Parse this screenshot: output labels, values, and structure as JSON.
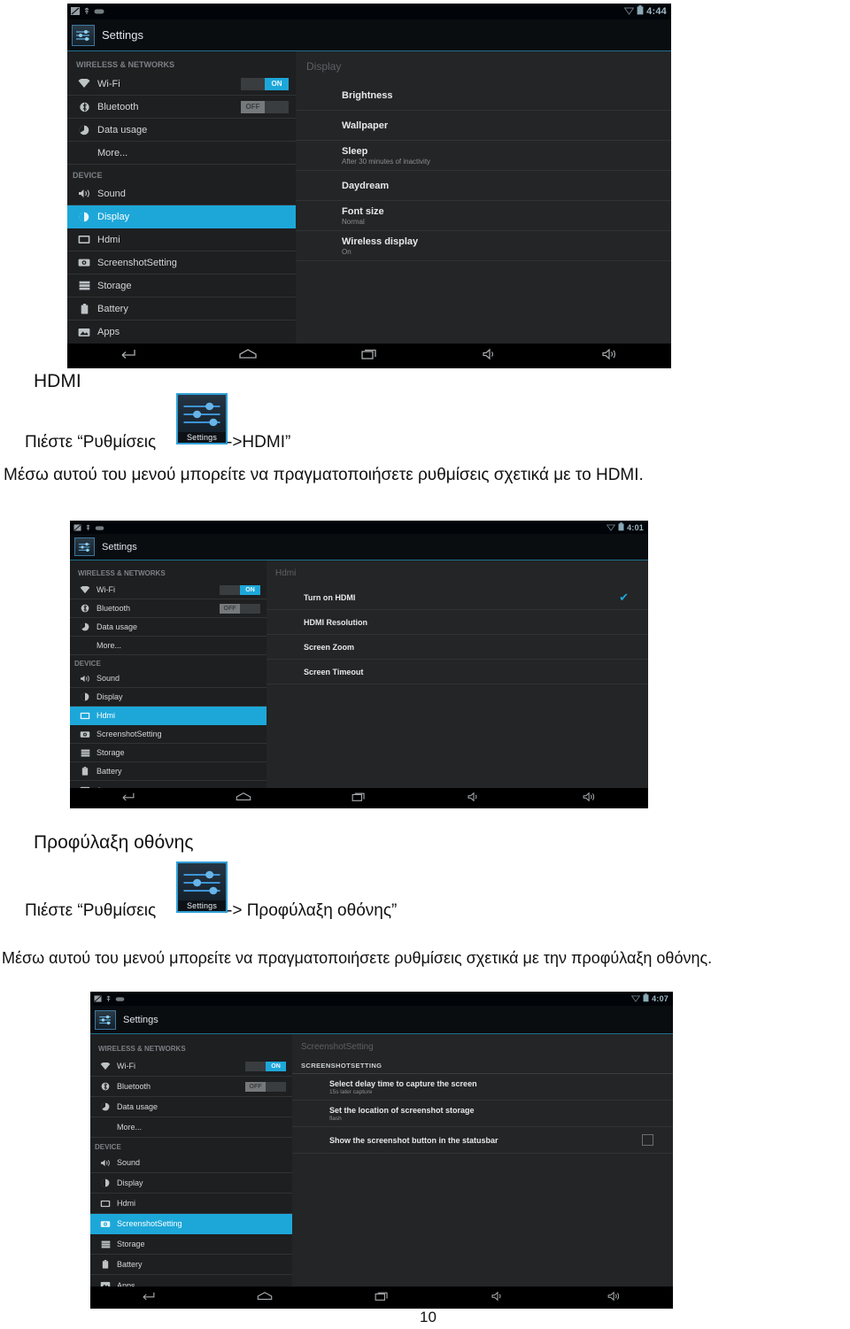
{
  "page": {
    "number": "10"
  },
  "screens": [
    {
      "id": "display-screen",
      "statusbar": {
        "clock": "4:44",
        "icons": [
          "screenshot-icon",
          "usb-icon",
          "battery-icon"
        ]
      },
      "actionbar": {
        "title": "Settings",
        "icon": "settings-app-icon"
      },
      "sidebar": {
        "groups": [
          {
            "label": "WIRELESS & NETWORKS",
            "items": [
              {
                "label": "Wi-Fi",
                "icon": "wifi-icon",
                "toggle": "ON",
                "toggle_state": "on",
                "selected": false
              },
              {
                "label": "Bluetooth",
                "icon": "bluetooth-icon",
                "toggle": "OFF",
                "toggle_state": "off",
                "selected": false
              },
              {
                "label": "Data usage",
                "icon": "data-usage-icon",
                "selected": false
              },
              {
                "label": "More...",
                "icon": "none",
                "selected": false
              }
            ]
          },
          {
            "label": "DEVICE",
            "items": [
              {
                "label": "Sound",
                "icon": "sound-icon",
                "selected": false
              },
              {
                "label": "Display",
                "icon": "display-icon",
                "selected": true
              },
              {
                "label": "Hdmi",
                "icon": "hdmi-icon",
                "selected": false
              },
              {
                "label": "ScreenshotSetting",
                "icon": "camera-icon",
                "selected": false
              },
              {
                "label": "Storage",
                "icon": "storage-icon",
                "selected": false
              },
              {
                "label": "Battery",
                "icon": "battery-icon",
                "selected": false
              },
              {
                "label": "Apps",
                "icon": "apps-icon",
                "selected": false
              }
            ]
          }
        ]
      },
      "content": {
        "title": "Display",
        "section_header": "",
        "rows": [
          {
            "main": "Brightness",
            "desc": "",
            "control": "none"
          },
          {
            "main": "Wallpaper",
            "desc": "",
            "control": "none"
          },
          {
            "main": "Sleep",
            "desc": "After 30 minutes of inactivity",
            "control": "none"
          },
          {
            "main": "Daydream",
            "desc": "",
            "control": "none"
          },
          {
            "main": "Font size",
            "desc": "Normal",
            "control": "none"
          },
          {
            "main": "Wireless display",
            "desc": "On",
            "control": "none"
          }
        ]
      },
      "navbar": [
        "back-icon",
        "home-icon",
        "recents-icon",
        "volume-down-icon",
        "volume-up-icon"
      ]
    },
    {
      "id": "hdmi-screen",
      "statusbar": {
        "clock": "4:01",
        "icons": [
          "screenshot-icon",
          "usb-icon",
          "battery-icon"
        ]
      },
      "actionbar": {
        "title": "Settings",
        "icon": "settings-app-icon"
      },
      "sidebar": {
        "groups": [
          {
            "label": "WIRELESS & NETWORKS",
            "items": [
              {
                "label": "Wi-Fi",
                "icon": "wifi-icon",
                "toggle": "ON",
                "toggle_state": "on",
                "selected": false
              },
              {
                "label": "Bluetooth",
                "icon": "bluetooth-icon",
                "toggle": "OFF",
                "toggle_state": "off",
                "selected": false
              },
              {
                "label": "Data usage",
                "icon": "data-usage-icon",
                "selected": false
              },
              {
                "label": "More...",
                "icon": "none",
                "selected": false
              }
            ]
          },
          {
            "label": "DEVICE",
            "items": [
              {
                "label": "Sound",
                "icon": "sound-icon",
                "selected": false
              },
              {
                "label": "Display",
                "icon": "display-icon",
                "selected": false
              },
              {
                "label": "Hdmi",
                "icon": "hdmi-icon",
                "selected": true
              },
              {
                "label": "ScreenshotSetting",
                "icon": "camera-icon",
                "selected": false
              },
              {
                "label": "Storage",
                "icon": "storage-icon",
                "selected": false
              },
              {
                "label": "Battery",
                "icon": "battery-icon",
                "selected": false
              },
              {
                "label": "Apps",
                "icon": "apps-icon",
                "selected": false
              }
            ]
          }
        ]
      },
      "content": {
        "title": "Hdmi",
        "section_header": "",
        "rows": [
          {
            "main": "Turn on HDMI",
            "desc": "",
            "control": "checkbox-checked"
          },
          {
            "main": "HDMI Resolution",
            "desc": "",
            "control": "none"
          },
          {
            "main": "Screen Zoom",
            "desc": "",
            "control": "none"
          },
          {
            "main": "Screen Timeout",
            "desc": "",
            "control": "none"
          }
        ]
      },
      "navbar": [
        "back-icon",
        "home-icon",
        "recents-icon",
        "volume-down-icon",
        "volume-up-icon"
      ]
    },
    {
      "id": "screenshotsetting-screen",
      "statusbar": {
        "clock": "4:07",
        "icons": [
          "screenshot-icon",
          "usb-icon",
          "battery-icon"
        ]
      },
      "actionbar": {
        "title": "Settings",
        "icon": "settings-app-icon"
      },
      "sidebar": {
        "groups": [
          {
            "label": "WIRELESS & NETWORKS",
            "items": [
              {
                "label": "Wi-Fi",
                "icon": "wifi-icon",
                "toggle": "ON",
                "toggle_state": "on",
                "selected": false
              },
              {
                "label": "Bluetooth",
                "icon": "bluetooth-icon",
                "toggle": "OFF",
                "toggle_state": "off",
                "selected": false
              },
              {
                "label": "Data usage",
                "icon": "data-usage-icon",
                "selected": false
              },
              {
                "label": "More...",
                "icon": "none",
                "selected": false
              }
            ]
          },
          {
            "label": "DEVICE",
            "items": [
              {
                "label": "Sound",
                "icon": "sound-icon",
                "selected": false
              },
              {
                "label": "Display",
                "icon": "display-icon",
                "selected": false
              },
              {
                "label": "Hdmi",
                "icon": "hdmi-icon",
                "selected": false
              },
              {
                "label": "ScreenshotSetting",
                "icon": "camera-icon",
                "selected": true
              },
              {
                "label": "Storage",
                "icon": "storage-icon",
                "selected": false
              },
              {
                "label": "Battery",
                "icon": "battery-icon",
                "selected": false
              },
              {
                "label": "Apps",
                "icon": "apps-icon",
                "selected": false
              }
            ]
          }
        ]
      },
      "content": {
        "title": "ScreenshotSetting",
        "section_header": "SCREENSHOTSETTING",
        "rows": [
          {
            "main": "Select delay time to capture the screen",
            "desc": "15s later capture",
            "control": "none"
          },
          {
            "main": "Set the location of screenshot storage",
            "desc": "flash",
            "control": "none"
          },
          {
            "main": "Show the screenshot button in the statusbar",
            "desc": "",
            "control": "checkbox-unchecked"
          }
        ]
      },
      "navbar": [
        "back-icon",
        "home-icon",
        "recents-icon",
        "volume-down-icon",
        "volume-up-icon"
      ]
    }
  ],
  "doc": {
    "hdmi_heading": "HDMI",
    "hdmi_instruction_pre": "Πιέστε “Ρυθμίσεις",
    "hdmi_instruction_post": "->HDMI”",
    "hdmi_paragraph": "Μέσω αυτού του μενού μπορείτε να πραγματοποιήσετε ρυθμίσεις σχετικά με το HDMI.",
    "daydream_heading": "Προφύλαξη οθόνης",
    "daydream_instruction_pre": "Πιέστε “Ρυθμίσεις",
    "daydream_instruction_post": "-> Προφύλαξη οθόνης”",
    "daydream_paragraph": "Μέσω αυτού του μενού μπορείτε να πραγματοποιήσετε ρυθμίσεις σχετικά  με την προφύλαξη οθόνης.",
    "settings_badge_label": "Settings"
  },
  "colors": {
    "accent": "#1da7d9",
    "screen_bg": "#1d1f21",
    "content_bg": "#232527",
    "text": "#d4d7d9"
  }
}
